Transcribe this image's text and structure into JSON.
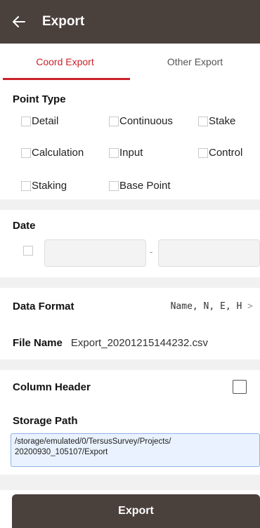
{
  "header": {
    "title": "Export"
  },
  "tabs": [
    {
      "label": "Coord Export",
      "active": true
    },
    {
      "label": "Other Export",
      "active": false
    }
  ],
  "point_type": {
    "label": "Point Type",
    "options": [
      {
        "label": "Detail",
        "checked": false
      },
      {
        "label": "Continuous",
        "checked": false
      },
      {
        "label": "Stake",
        "checked": false
      },
      {
        "label": "Calculation",
        "checked": false
      },
      {
        "label": "Input",
        "checked": false
      },
      {
        "label": "Control",
        "checked": false
      },
      {
        "label": "Staking",
        "checked": false
      },
      {
        "label": "Base Point",
        "checked": false
      }
    ]
  },
  "date": {
    "label": "Date",
    "enabled": false,
    "separator": "-",
    "start": "",
    "end": ""
  },
  "data_format": {
    "label": "Data Format",
    "value": "Name, N, E, H",
    "chevron": ">"
  },
  "file_name": {
    "label": "File Name",
    "value": "Export_20201215144232.csv"
  },
  "column_header": {
    "label": "Column Header",
    "checked": false
  },
  "storage_path": {
    "label": "Storage Path",
    "line1": "/storage/emulated/0/TersusSurvey/Projects/",
    "line2": "20200930_105107/Export"
  },
  "export_button": {
    "label": "Export"
  },
  "colors": {
    "header_bg": "#4a403c",
    "accent": "#cc2229",
    "path_bg": "#e9f2fe"
  }
}
